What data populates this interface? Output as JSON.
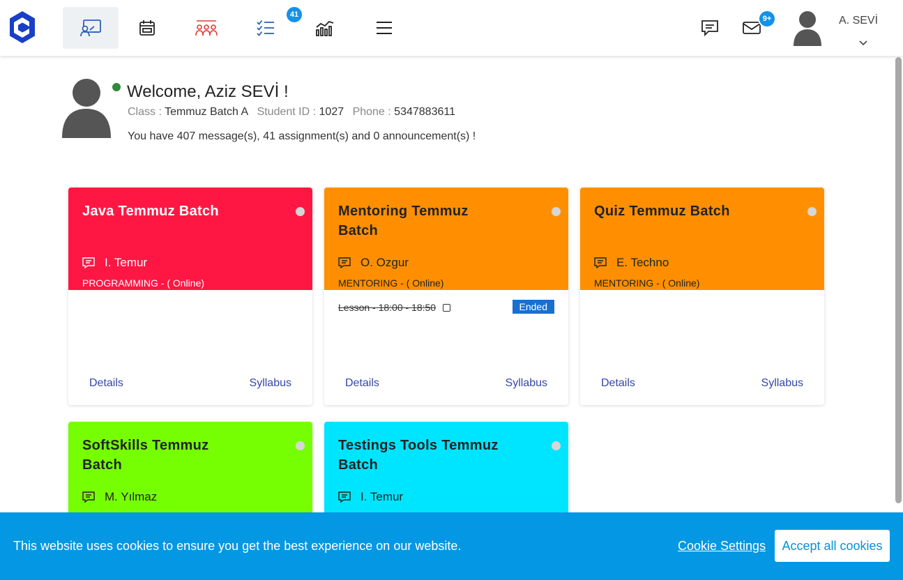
{
  "nav": {
    "assignments_badge": "41",
    "messages_badge": "9+",
    "user_name": "A. SEVİ"
  },
  "profile": {
    "welcome": "Welcome, Aziz SEVİ !",
    "class_label": "Class :",
    "class_value": "Temmuz Batch A",
    "student_id_label": "Student ID :",
    "student_id_value": "1027",
    "phone_label": "Phone :",
    "phone_value": "5347883611",
    "summary": "You have 407 message(s), 41 assignment(s) and 0 announcement(s) !"
  },
  "cards": [
    {
      "title": "Java Temmuz Batch",
      "teacher": "I. Temur",
      "type": "PROGRAMMING - ( Online)",
      "details": "Details",
      "syllabus": "Syllabus",
      "color": "#ff1744"
    },
    {
      "title": "Mentoring Temmuz Batch",
      "teacher": "O. Ozgur",
      "type": "MENTORING - ( Online)",
      "details": "Details",
      "syllabus": "Syllabus",
      "lesson": "Lesson - 18:00 - 18:50",
      "status": "Ended",
      "color": "#ff8f00"
    },
    {
      "title": "Quiz Temmuz Batch",
      "teacher": "E. Techno",
      "type": "MENTORING - ( Online)",
      "details": "Details",
      "syllabus": "Syllabus",
      "color": "#ff8f00"
    },
    {
      "title": "SoftSkills Temmuz Batch",
      "teacher": "M. Yılmaz",
      "color": "#76ff03"
    },
    {
      "title": "Testings Tools Temmuz Batch",
      "teacher": "I. Temur",
      "color": "#00e5ff"
    }
  ],
  "cookie": {
    "message": "This website uses cookies to ensure you get the best experience on our website.",
    "settings": "Cookie Settings",
    "accept": "Accept all cookies"
  }
}
